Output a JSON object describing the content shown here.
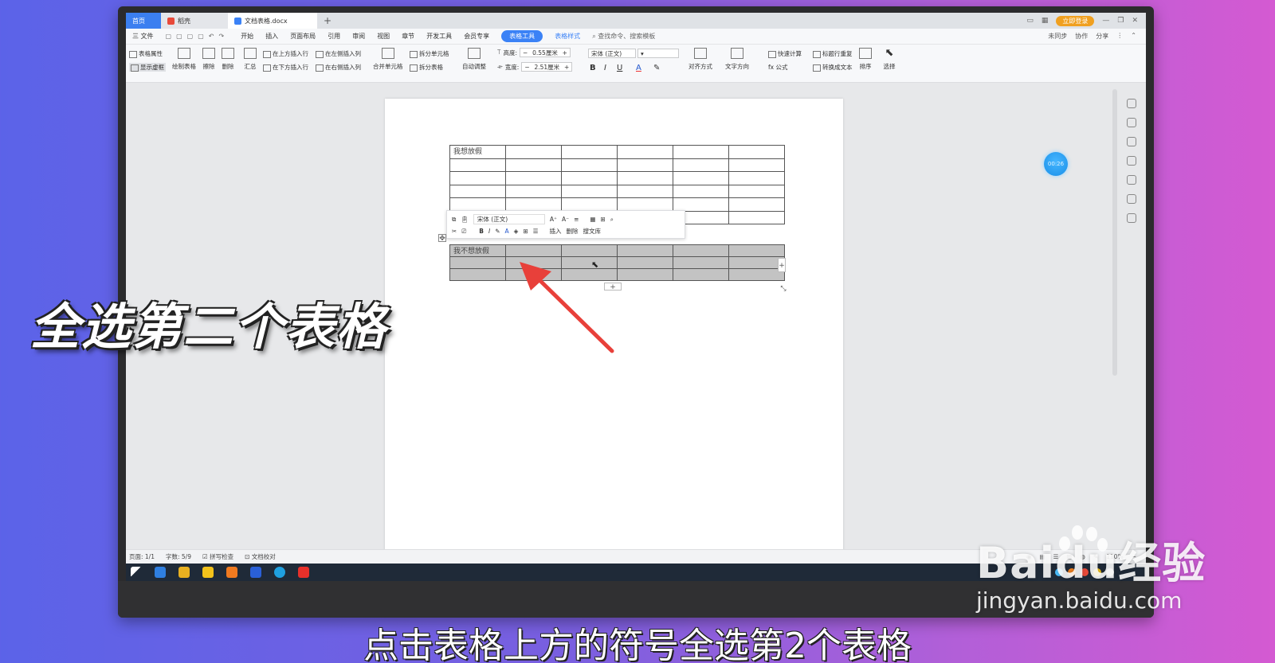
{
  "window": {
    "tabs": [
      {
        "label": "首页"
      },
      {
        "label": "稻壳"
      },
      {
        "label": "文档表格.docx"
      }
    ],
    "new_tab": "+",
    "login_button": "立即登录"
  },
  "menu": {
    "file": "三 文件",
    "items": [
      "开始",
      "插入",
      "页面布局",
      "引用",
      "审阅",
      "视图",
      "章节",
      "开发工具",
      "会员专享"
    ],
    "active": "表格工具",
    "secondary": "表格样式",
    "search": "查找命令、搜索模板",
    "right": [
      "未同步",
      "协作",
      "分享"
    ]
  },
  "ribbon": {
    "table_props": "表格属性",
    "show_gridlines": "显示虚框",
    "draw_table": "绘制表格",
    "erase": "擦除",
    "delete": "删除",
    "summary": "汇总",
    "insert_above": "在上方插入行",
    "insert_below": "在下方插入行",
    "insert_left": "在左侧插入列",
    "insert_right": "在右侧插入列",
    "merge_cells": "合并单元格",
    "split_cells": "拆分单元格",
    "split_table": "拆分表格",
    "auto_fit": "自动调整",
    "height_label": "高度:",
    "height_value": "0.55厘米",
    "width_label": "宽度:",
    "width_value": "2.51厘米",
    "font_name": "宋体 (正文)",
    "bold": "B",
    "italic": "I",
    "underline": "U",
    "font_color": "A",
    "align": "对齐方式",
    "text_direction": "文字方向",
    "quick_calc": "快速计算",
    "formula": "fx 公式",
    "repeat_header": "标题行重复",
    "to_text": "转换成文本",
    "sort": "排序",
    "select": "选择"
  },
  "document": {
    "table1": {
      "rows": [
        [
          "我想放假",
          "",
          "",
          "",
          "",
          ""
        ],
        [
          "",
          "",
          "",
          "",
          "",
          ""
        ],
        [
          "",
          "",
          "",
          "",
          "",
          ""
        ],
        [
          "",
          "",
          "",
          "",
          "",
          ""
        ],
        [
          "",
          "",
          "",
          "",
          "",
          ""
        ],
        [
          "",
          "",
          "",
          "",
          "",
          ""
        ]
      ]
    },
    "table2": {
      "rows": [
        [
          "我不想放假",
          "",
          "",
          "",
          "",
          ""
        ],
        [
          "",
          "",
          "",
          "",
          "",
          ""
        ],
        [
          "",
          "",
          "",
          "",
          "",
          ""
        ]
      ]
    },
    "add_row": "+",
    "add_col": "+",
    "move_handle": "✥"
  },
  "mini_toolbar": {
    "font": "宋体 (正文)",
    "bold": "B",
    "italic": "I",
    "insert": "插入",
    "delete": "删除",
    "search_lib": "搜文库"
  },
  "timer": "00:26",
  "status": {
    "page": "页面: 1/1",
    "words": "字数: 5/9",
    "spell": "拼写检查",
    "proof": "文档校对",
    "zoom": "110%"
  },
  "overlay": {
    "step_title": "全选第二个表格",
    "subtitle": "点击表格上方的符号全选第2个表格"
  },
  "watermark": {
    "brand": "Baidu经验",
    "site": "jingyan.baidu.com"
  },
  "colors": {
    "accent": "#3b82f6",
    "arrow": "#e8403a",
    "selection": "#c3c3c3"
  }
}
